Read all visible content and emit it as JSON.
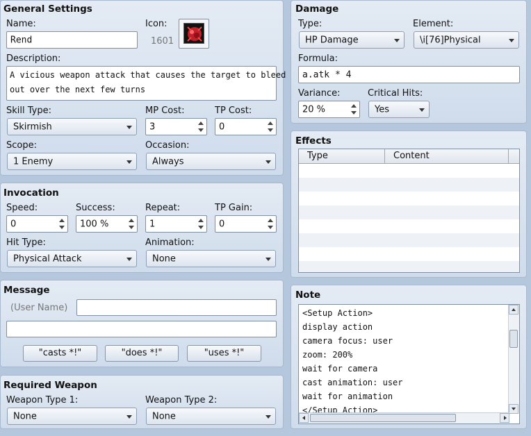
{
  "general": {
    "title": "General Settings",
    "name_label": "Name:",
    "name_value": "Rend",
    "icon_label": "Icon:",
    "icon_index": "1601",
    "description_label": "Description:",
    "description_line1": "A vicious weapon attack that causes the target to bleed",
    "description_line2": "out over the next few turns",
    "skill_type_label": "Skill Type:",
    "skill_type_value": "Skirmish",
    "mp_cost_label": "MP Cost:",
    "mp_cost_value": "3",
    "tp_cost_label": "TP Cost:",
    "tp_cost_value": "0",
    "scope_label": "Scope:",
    "scope_value": "1 Enemy",
    "occasion_label": "Occasion:",
    "occasion_value": "Always"
  },
  "invocation": {
    "title": "Invocation",
    "speed_label": "Speed:",
    "speed_value": "0",
    "success_label": "Success:",
    "success_value": "100 %",
    "repeat_label": "Repeat:",
    "repeat_value": "1",
    "tp_gain_label": "TP Gain:",
    "tp_gain_value": "0",
    "hit_type_label": "Hit Type:",
    "hit_type_value": "Physical Attack",
    "animation_label": "Animation:",
    "animation_value": "None"
  },
  "message": {
    "title": "Message",
    "user_name_placeholder": "(User Name)",
    "line1_value": "",
    "line2_value": "",
    "buttons": [
      "\"casts *!\"",
      "\"does *!\"",
      "\"uses *!\""
    ]
  },
  "required_weapon": {
    "title": "Required Weapon",
    "type1_label": "Weapon Type 1:",
    "type1_value": "None",
    "type2_label": "Weapon Type 2:",
    "type2_value": "None"
  },
  "damage": {
    "title": "Damage",
    "type_label": "Type:",
    "type_value": "HP Damage",
    "element_label": "Element:",
    "element_value": "\\i[76]Physical",
    "formula_label": "Formula:",
    "formula_value": "a.atk * 4",
    "variance_label": "Variance:",
    "variance_value": "20 %",
    "critical_label": "Critical Hits:",
    "critical_value": "Yes"
  },
  "effects": {
    "title": "Effects",
    "columns": [
      "Type",
      "Content"
    ]
  },
  "note": {
    "title": "Note",
    "lines": [
      "<Setup Action>",
      "display action",
      "camera focus: user",
      "zoom: 200%",
      "wait for camera",
      "cast animation: user",
      "wait for animation",
      "</Setup Action>"
    ]
  },
  "colors": {
    "background": "#b5c7dd",
    "panel": "#dbe4f0",
    "icon_red": "#c0202a"
  }
}
